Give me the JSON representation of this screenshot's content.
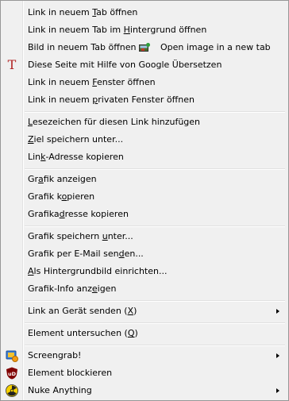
{
  "menu": {
    "items": [
      {
        "pre": "Link in neuem ",
        "ul": "T",
        "post": "ab öffnen"
      },
      {
        "pre": "Link in neuem Tab im ",
        "ul": "H",
        "post": "intergrund öffnen"
      },
      {
        "pre": "Bild in neuem Tab öffnen",
        "ul": "",
        "post": "",
        "extra": "Open image in a new tab"
      },
      {
        "pre": "Diese Seite mit Hilfe von Google Übersetzen",
        "ul": "",
        "post": ""
      },
      {
        "pre": "Link in neuem ",
        "ul": "F",
        "post": "enster öffnen"
      },
      {
        "pre": "Link in neuem ",
        "ul": "p",
        "post": "rivaten Fenster öffnen"
      },
      {
        "pre": "",
        "ul": "L",
        "post": "esezeichen für diesen Link hinzufügen"
      },
      {
        "pre": "",
        "ul": "Z",
        "post": "iel speichern unter..."
      },
      {
        "pre": "Lin",
        "ul": "k",
        "post": "-Adresse kopieren"
      },
      {
        "pre": "Gr",
        "ul": "a",
        "post": "fik anzeigen"
      },
      {
        "pre": "Grafik k",
        "ul": "o",
        "post": "pieren"
      },
      {
        "pre": "Grafika",
        "ul": "d",
        "post": "resse kopieren"
      },
      {
        "pre": "Grafik speichern ",
        "ul": "u",
        "post": "nter..."
      },
      {
        "pre": "Grafik per E-Mail sen",
        "ul": "d",
        "post": "en..."
      },
      {
        "pre": "",
        "ul": "A",
        "post": "ls Hintergrundbild einrichten..."
      },
      {
        "pre": "Grafik-Info anz",
        "ul": "e",
        "post": "igen"
      },
      {
        "pre": "Link an Gerät senden (",
        "ul": "X",
        "post": ")"
      },
      {
        "pre": "Element untersuchen (",
        "ul": "Q",
        "post": ")"
      },
      {
        "pre": "Screengrab!",
        "ul": "",
        "post": ""
      },
      {
        "pre": "Element blockieren",
        "ul": "",
        "post": ""
      },
      {
        "pre": "Nuke Anything",
        "ul": "",
        "post": ""
      }
    ]
  },
  "icons": {
    "translate": "T",
    "ublock": "uD"
  },
  "colors": {
    "menu_bg": "#f0f0f0",
    "border": "#979797",
    "translate_icon": "#b22222",
    "ublock_icon": "#800000"
  }
}
